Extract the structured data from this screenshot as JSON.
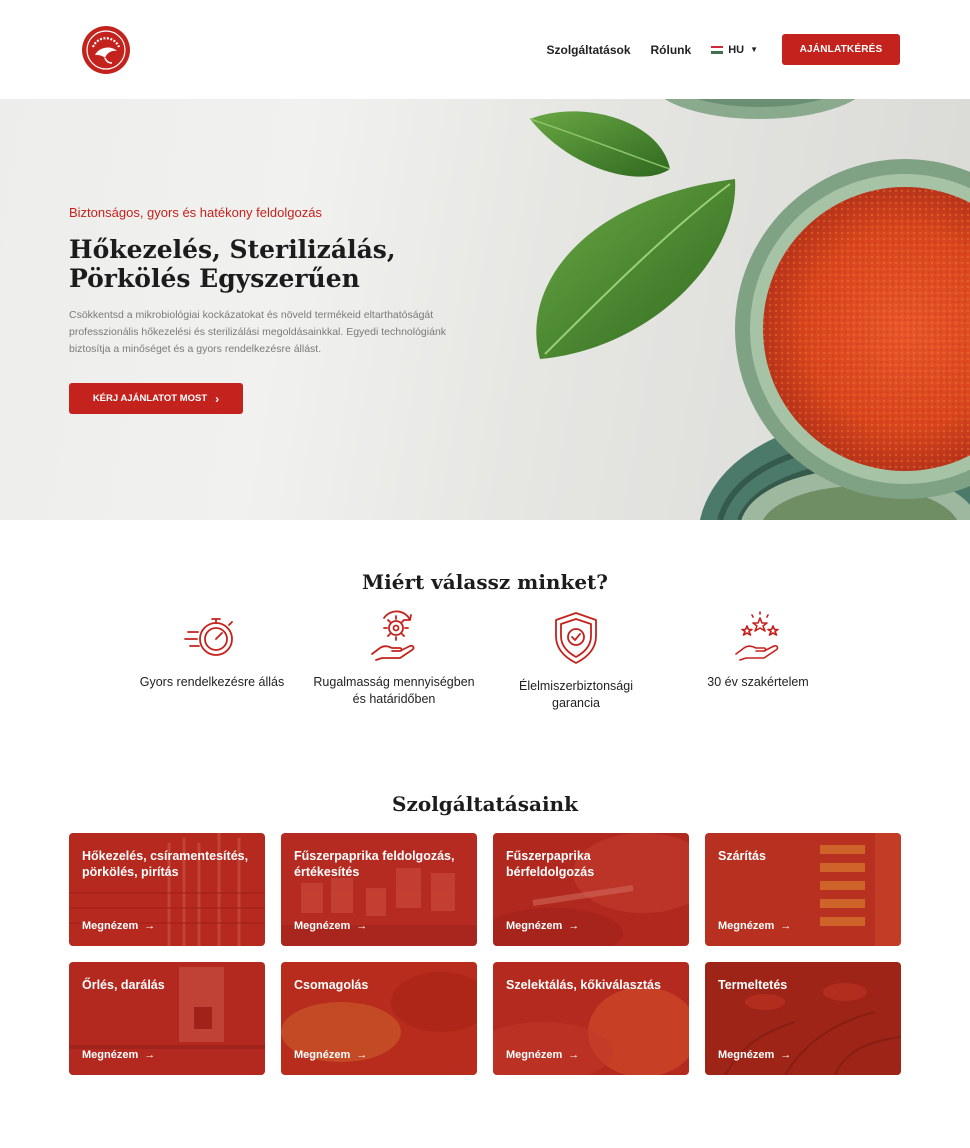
{
  "header": {
    "logo_text": "MATONGAYPA",
    "nav": [
      "Szolgáltatások",
      "Rólunk"
    ],
    "lang": "HU",
    "cta": "AJÁNLATKÉRÉS"
  },
  "hero": {
    "kicker": "Biztonságos, gyors és hatékony feldolgozás",
    "title_line1": "Hőkezelés, Sterilizálás,",
    "title_line2": "Pörkölés Egyszerűen",
    "text": "Csökkentsd a mikrobiológiai kockázatokat és növeld termékeid eltarthatóságát professzionális hőkezelési és sterilizálási megoldásainkkal. Egyedi technológiánk biztosítja a minőséget és a gyors rendelkezésre állást.",
    "button": "KÉRJ AJÁNLATOT MOST",
    "button_icon": "chevron-right-icon"
  },
  "why": {
    "title": "Miért válassz minket?",
    "features": [
      {
        "icon": "stopwatch-icon",
        "label_line1": "Gyors rendelkezésre állás",
        "label_line2": ""
      },
      {
        "icon": "gear-hand-icon",
        "label_line1": "Rugalmasság mennyiségben",
        "label_line2": "és határidőben"
      },
      {
        "icon": "shield-check-icon",
        "label_line1": "Élelmiszerbiztonsági",
        "label_line2": "garancia"
      },
      {
        "icon": "stars-hand-icon",
        "label_line1": "30 év szakértelem",
        "label_line2": ""
      }
    ]
  },
  "services": {
    "title": "Szolgáltatásaink",
    "link_label": "Megnézem",
    "items": [
      {
        "title": "Hőkezelés, csíramentesítés, pörkölés, pirítás"
      },
      {
        "title": "Fűszerpaprika feldolgozás, értékesítés"
      },
      {
        "title": "Fűszerpaprika bérfeldolgozás"
      },
      {
        "title": "Szárítás"
      },
      {
        "title": "Őrlés, darálás"
      },
      {
        "title": "Csomagolás"
      },
      {
        "title": "Szelektálás, kőkiválasztás"
      },
      {
        "title": "Termeltetés"
      }
    ]
  },
  "colors": {
    "brand_red": "#c4221d",
    "card_overlay": "#b3281f",
    "text_dark": "#1c1c1c",
    "text_muted": "#7a7a7a"
  }
}
